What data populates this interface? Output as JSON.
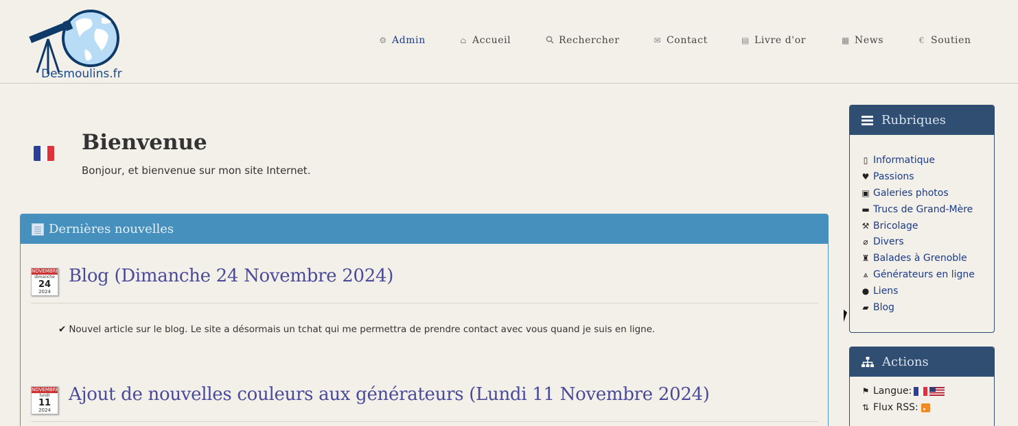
{
  "header": {
    "logo_text": "Desmoulins.fr",
    "nav": [
      {
        "label": "Admin",
        "icon": "gears-icon"
      },
      {
        "label": "Accueil",
        "icon": "home-icon"
      },
      {
        "label": "Rechercher",
        "icon": "search-icon"
      },
      {
        "label": "Contact",
        "icon": "envelope-icon"
      },
      {
        "label": "Livre d'or",
        "icon": "book-icon"
      },
      {
        "label": "News",
        "icon": "calendar-icon"
      },
      {
        "label": "Soutien",
        "icon": "euro-icon"
      }
    ]
  },
  "welcome": {
    "title": "Bienvenue",
    "text": "Bonjour, et bienvenue sur mon site Internet."
  },
  "news": {
    "heading": "Dernières nouvelles",
    "items": [
      {
        "cal_month": "NOVEMBRE",
        "cal_day": "dimanche",
        "cal_num": "24",
        "cal_year": "2024",
        "title": "Blog (Dimanche 24 Novembre 2024)",
        "body": "Nouvel article sur le blog. Le site a désormais un tchat qui me permettra de prendre contact avec vous quand je suis en ligne."
      },
      {
        "cal_month": "NOVEMBRE",
        "cal_day": "lundi",
        "cal_num": "11",
        "cal_year": "2024",
        "title": "Ajout de nouvelles couleurs aux générateurs (Lundi 11 Novembre 2024)",
        "body": ""
      }
    ]
  },
  "sidebar": {
    "rubriques": {
      "heading": "Rubriques",
      "items": [
        {
          "label": "Informatique",
          "icon": "mobile-icon"
        },
        {
          "label": "Passions",
          "icon": "heart-icon"
        },
        {
          "label": "Galeries photos",
          "icon": "picture-icon"
        },
        {
          "label": "Trucs de Grand-Mère",
          "icon": "comment-icon"
        },
        {
          "label": "Bricolage",
          "icon": "wrench-icon"
        },
        {
          "label": "Divers",
          "icon": "paperclip-icon"
        },
        {
          "label": "Balades à Grenoble",
          "icon": "tower-icon"
        },
        {
          "label": "Générateurs en ligne",
          "icon": "road-icon"
        },
        {
          "label": "Liens",
          "icon": "globe-icon"
        },
        {
          "label": "Blog",
          "icon": "briefcase-icon"
        }
      ]
    },
    "actions": {
      "heading": "Actions",
      "langue_label": "Langue:",
      "rss_label": "Flux RSS:"
    }
  },
  "colors": {
    "news_header": "#4690be",
    "sidebar_header": "#2f4e72",
    "link": "#1a3a8a",
    "background": "#f3f0e9"
  }
}
